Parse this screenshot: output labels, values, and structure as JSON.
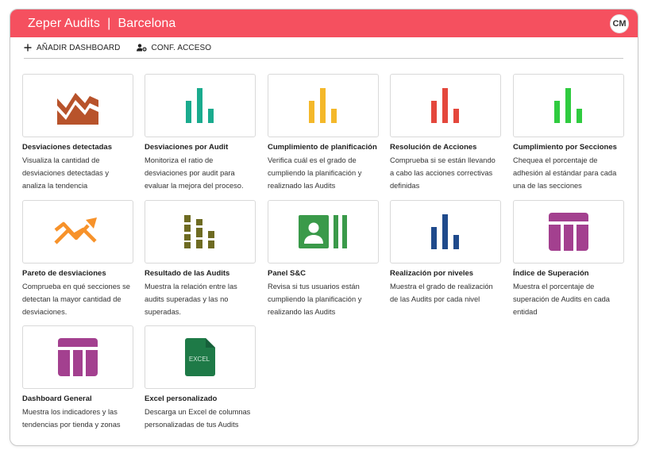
{
  "header": {
    "title": "Zeper Audits  |  Barcelona",
    "avatar_initials": "CM",
    "accent_color": "#f5505f"
  },
  "toolbar": {
    "add_dashboard_label": "AÑADIR DASHBOARD",
    "access_config_label": "CONF. ACCESO"
  },
  "cards": [
    {
      "title": "Desviaciones detectadas",
      "description": "Visualiza la cantidad de desviaciones detectadas y analiza la tendencia",
      "icon": "area-chart-icon",
      "color": "#b8532b"
    },
    {
      "title": "Desviaciones por Audit",
      "description": "Monitoriza el ratio de desviaciones por audit para evaluar la mejora del proceso.",
      "icon": "bar-chart-icon",
      "color": "#1aab8e"
    },
    {
      "title": "Cumplimiento de planificación",
      "description": "Verifica cuál es el grado de cumpliendo la planificación y realiznado las Audits",
      "icon": "bar-chart-icon",
      "color": "#f4b82a"
    },
    {
      "title": "Resolución de Acciones",
      "description": "Comprueba si se están llevando a cabo las acciones correctivas definidas",
      "icon": "bar-chart-icon",
      "color": "#e4473c"
    },
    {
      "title": "Cumplimiento por Secciones",
      "description": "Chequea el porcentaje de adhesión al estándar para cada una de las secciones",
      "icon": "bar-chart-icon",
      "color": "#2fcb3f"
    },
    {
      "title": "Pareto de desviaciones",
      "description": "Comprueba en qué secciones se detectan la mayor cantidad de desviaciones.",
      "icon": "trend-chart-icon",
      "color": "#f7922a"
    },
    {
      "title": "Resultado de las Audits",
      "description": "Muestra la relación entre las audits superadas y las no superadas.",
      "icon": "stacked-bar-icon",
      "color": "#6e6b22"
    },
    {
      "title": "Panel S&C",
      "description": "Revisa si tus usuarios están cumpliendo la planificación y realizando las Audits",
      "icon": "contact-panel-icon",
      "color": "#3a9a4a"
    },
    {
      "title": "Realización por niveles",
      "description": "Muestra el grado de realización de las Audits por cada nivel",
      "icon": "bar-chart-icon",
      "color": "#1f4a8c"
    },
    {
      "title": "Índice de Superación",
      "description": "Muestra el porcentaje de superación de Audits en cada entidad",
      "icon": "table-icon",
      "color": "#a3408f"
    },
    {
      "title": "Dashboard General",
      "description": "Muestra los indicadores y las tendencias por tienda y zonas",
      "icon": "table-icon",
      "color": "#a3408f"
    },
    {
      "title": "Excel personalizado",
      "description": "Descarga un Excel de columnas personalizadas de tus Audits",
      "icon": "excel-file-icon",
      "color": "#1e7a47",
      "icon_text": "EXCEL"
    }
  ]
}
